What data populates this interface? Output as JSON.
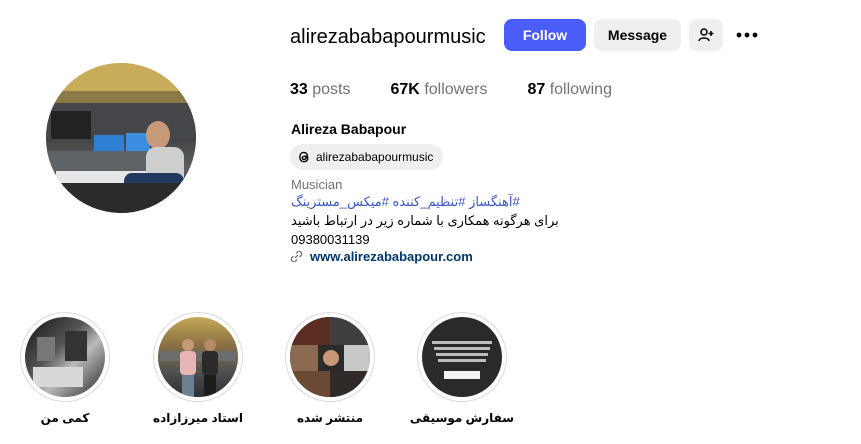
{
  "profile": {
    "username": "alirezababapourmusic",
    "full_name": "Alireza Babapour",
    "threads_handle": "alirezababapourmusic",
    "category": "Musician",
    "bio_tags": "#آهنگساز #تنظیم_کننده #میکس_مسترینگ",
    "bio_line": "برای هرگونه همکاری با شماره زیر در ارتباط باشید",
    "bio_phone": "09380031139",
    "website": "www.alirezababapour.com"
  },
  "actions": {
    "follow_label": "Follow",
    "message_label": "Message",
    "add_user_icon": "person-add-icon",
    "more_icon": "more-options-icon"
  },
  "stats": [
    {
      "count": "33",
      "label": "posts"
    },
    {
      "count": "67K",
      "label": "followers"
    },
    {
      "count": "87",
      "label": "following"
    }
  ],
  "highlights": [
    {
      "label": "کمی من"
    },
    {
      "label": "استاد میرزازاده"
    },
    {
      "label": "منتشر شده"
    },
    {
      "label": "سفارش موسیقی"
    }
  ],
  "colors": {
    "accent": "#4a5df9",
    "hashtag": "#3858c6",
    "link": "#00376b",
    "muted": "#737373",
    "button_bg": "#efefef"
  }
}
